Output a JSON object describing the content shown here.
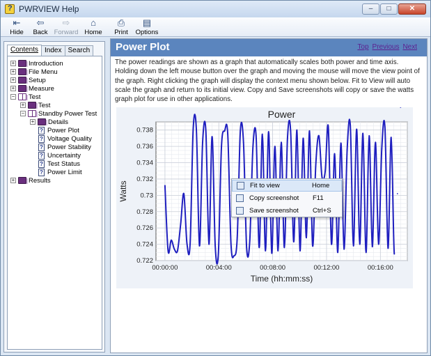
{
  "window": {
    "title": "PWRVIEW Help",
    "min": "–",
    "max": "□",
    "close": "✕"
  },
  "toolbar": [
    {
      "label": "Hide",
      "icon": "hide-icon",
      "glyph": "⇤",
      "disabled": false
    },
    {
      "label": "Back",
      "icon": "back-icon",
      "glyph": "⇦",
      "disabled": false
    },
    {
      "label": "Forward",
      "icon": "forward-icon",
      "glyph": "⇨",
      "disabled": true
    },
    {
      "label": "Home",
      "icon": "home-icon",
      "glyph": "⌂",
      "disabled": false
    },
    {
      "label": "Print",
      "icon": "print-icon",
      "glyph": "⎙",
      "disabled": false
    },
    {
      "label": "Options",
      "icon": "options-icon",
      "glyph": "▤",
      "disabled": false
    }
  ],
  "tabs": [
    "Contents",
    "Index",
    "Search"
  ],
  "tree": [
    {
      "label": "Introduction",
      "expander": "+",
      "icon": "book"
    },
    {
      "label": "File Menu",
      "expander": "+",
      "icon": "book"
    },
    {
      "label": "Setup",
      "expander": "+",
      "icon": "book"
    },
    {
      "label": "Measure",
      "expander": "+",
      "icon": "book"
    },
    {
      "label": "Test",
      "expander": "−",
      "icon": "book-open"
    },
    {
      "label": "Test",
      "expander": "+",
      "icon": "book"
    },
    {
      "label": "Standby Power Test",
      "expander": "−",
      "icon": "book-open"
    },
    {
      "label": "Details",
      "expander": "+",
      "icon": "book"
    },
    {
      "label": "Power Plot",
      "expander": "",
      "icon": "page"
    },
    {
      "label": "Voltage Quality",
      "expander": "",
      "icon": "page"
    },
    {
      "label": "Power Stability",
      "expander": "",
      "icon": "page"
    },
    {
      "label": "Uncertainty",
      "expander": "",
      "icon": "page"
    },
    {
      "label": "Test Status",
      "expander": "",
      "icon": "page"
    },
    {
      "label": "Power Limit",
      "expander": "",
      "icon": "page"
    },
    {
      "label": "Results",
      "expander": "+",
      "icon": "book"
    }
  ],
  "topic": {
    "title": "Power Plot",
    "nav": [
      "Top",
      "Previous",
      "Next"
    ],
    "paragraph": "The power readings are shown as a graph that automatically scales both power and time axis. Holding down the left mouse button over the graph and moving the mouse will move the view point of the graph. Right clicking the graph will display the context menu shown below. Fit to View will auto scale the graph and return to its initial view. Copy and Save screenshots will copy or save the watts graph plot for use in other applications."
  },
  "chart_data": {
    "type": "line",
    "title": "Power",
    "xlabel": "Time (hh:mm:ss)",
    "ylabel": "Watts",
    "xticks": [
      "00:00:00",
      "00:04:00",
      "00:08:00",
      "00:12:00",
      "00:16:00"
    ],
    "yticks": [
      "0.722",
      "0.724",
      "0.726",
      "0.728",
      "0.73",
      "0.732",
      "0.734",
      "0.736",
      "0.738"
    ],
    "ylim": [
      0.722,
      0.739
    ],
    "xlim_seconds": [
      -40,
      1080
    ],
    "grid": true,
    "series": [
      {
        "color": "#1f1fbf",
        "t": [
          0,
          14,
          28,
          42,
          56,
          70,
          84,
          98,
          112,
          126,
          140,
          154,
          168,
          182,
          196,
          210,
          224,
          238,
          252,
          266,
          280,
          294,
          308,
          322,
          336,
          350,
          364,
          378,
          392,
          406,
          420,
          434,
          448,
          462,
          476,
          490,
          504,
          518,
          532,
          546,
          560,
          574,
          588,
          602,
          616,
          630,
          644,
          658,
          672,
          686,
          700,
          714,
          728,
          742,
          756,
          770,
          784,
          798,
          812,
          826,
          840,
          854,
          868,
          882,
          896,
          910,
          924,
          938,
          952,
          966,
          980,
          994,
          1008,
          1022,
          1036,
          1050
        ],
        "values": [
          0.7312,
          0.7232,
          0.7245,
          0.7234,
          0.7232,
          0.7265,
          0.7302,
          0.7241,
          0.724,
          0.7382,
          0.7381,
          0.7238,
          0.7365,
          0.738,
          0.724,
          0.7372,
          0.7238,
          0.7228,
          0.736,
          0.7379,
          0.7375,
          0.7241,
          0.7226,
          0.7248,
          0.7379,
          0.7365,
          0.7236,
          0.7244,
          0.7358,
          0.7373,
          0.7236,
          0.7375,
          0.7232,
          0.7378,
          0.7229,
          0.736,
          0.7232,
          0.7365,
          0.7236,
          0.737,
          0.7379,
          0.7243,
          0.738,
          0.7232,
          0.737,
          0.7248,
          0.7379,
          0.7238,
          0.7337,
          0.7373,
          0.7322,
          0.7329,
          0.7384,
          0.724,
          0.7351,
          0.723,
          0.7364,
          0.7234,
          0.7356,
          0.7386,
          0.7238,
          0.7381,
          0.724,
          0.7376,
          0.723,
          0.7373,
          0.7237,
          0.7365,
          0.724,
          0.7357,
          0.7384,
          0.7235,
          0.7371,
          0.7228,
          0.7302
        ]
      }
    ]
  },
  "context_menu": [
    {
      "label": "Fit to view",
      "shortcut": "Home",
      "icon": "fit-icon",
      "glyph": "⤢"
    },
    {
      "label": "Copy screenshot",
      "shortcut": "F11",
      "icon": "copy-icon",
      "glyph": "❐"
    },
    {
      "label": "Save screenshot",
      "shortcut": "Ctrl+S",
      "icon": "save-icon",
      "glyph": "▣"
    }
  ]
}
